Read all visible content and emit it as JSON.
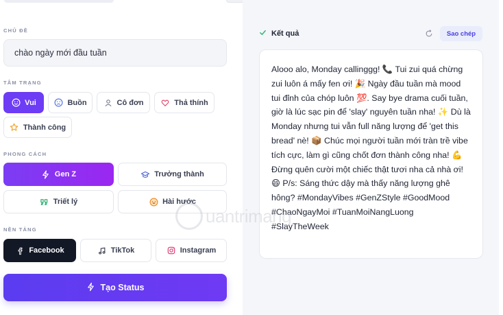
{
  "form": {
    "topic_label": "CHỦ ĐỀ",
    "topic_value": "chào ngày mới đầu tuần",
    "mood_label": "TÂM TRẠNG",
    "moods": [
      "Vui",
      "Buồn",
      "Cô đơn",
      "Thả thính",
      "Thành công"
    ],
    "selected_mood": "Vui",
    "style_label": "PHONG CÁCH",
    "styles": [
      "Gen Z",
      "Trưởng thành",
      "Triết lý",
      "Hài hước"
    ],
    "selected_style": "Gen Z",
    "platform_label": "NỀN TẢNG",
    "platforms": [
      "Facebook",
      "TikTok",
      "Instagram"
    ],
    "selected_platform": "Facebook",
    "submit_label": "Tạo Status"
  },
  "result": {
    "title": "Kết quả",
    "copy_label": "Sao chép",
    "text": "Alooo alo, Monday callinggg! 📞 Tui zui quá chừng zui luôn á mấy fen ơi! 🎉 Ngày đầu tuần mà mood tui đỉnh của chóp luôn 💯. Say bye drama cuối tuần, giờ là lúc sạc pin để 'slay' nguyên tuần nha! ✨ Dù là Monday nhưng tui vẫn full năng lượng để 'get this bread' nè! 📦 Chúc mọi người tuần mới tràn trề vibe tích cực, làm gì cũng chốt đơn thành công nha! 💪 Đừng quên cười một chiếc thật tươi nha cả nhà ơi! 😄 P/s: Sáng thức dậy mà thấy năng lượng ghê hông? #MondayVibes #GenZStyle #GoodMood #ChaoNgayMoi #TuanMoiNangLuong #SlayTheWeek"
  },
  "watermark": "uantrimang",
  "colors": {
    "accent": "#6d3cf5",
    "success": "#2bb673",
    "dark": "#121826"
  }
}
